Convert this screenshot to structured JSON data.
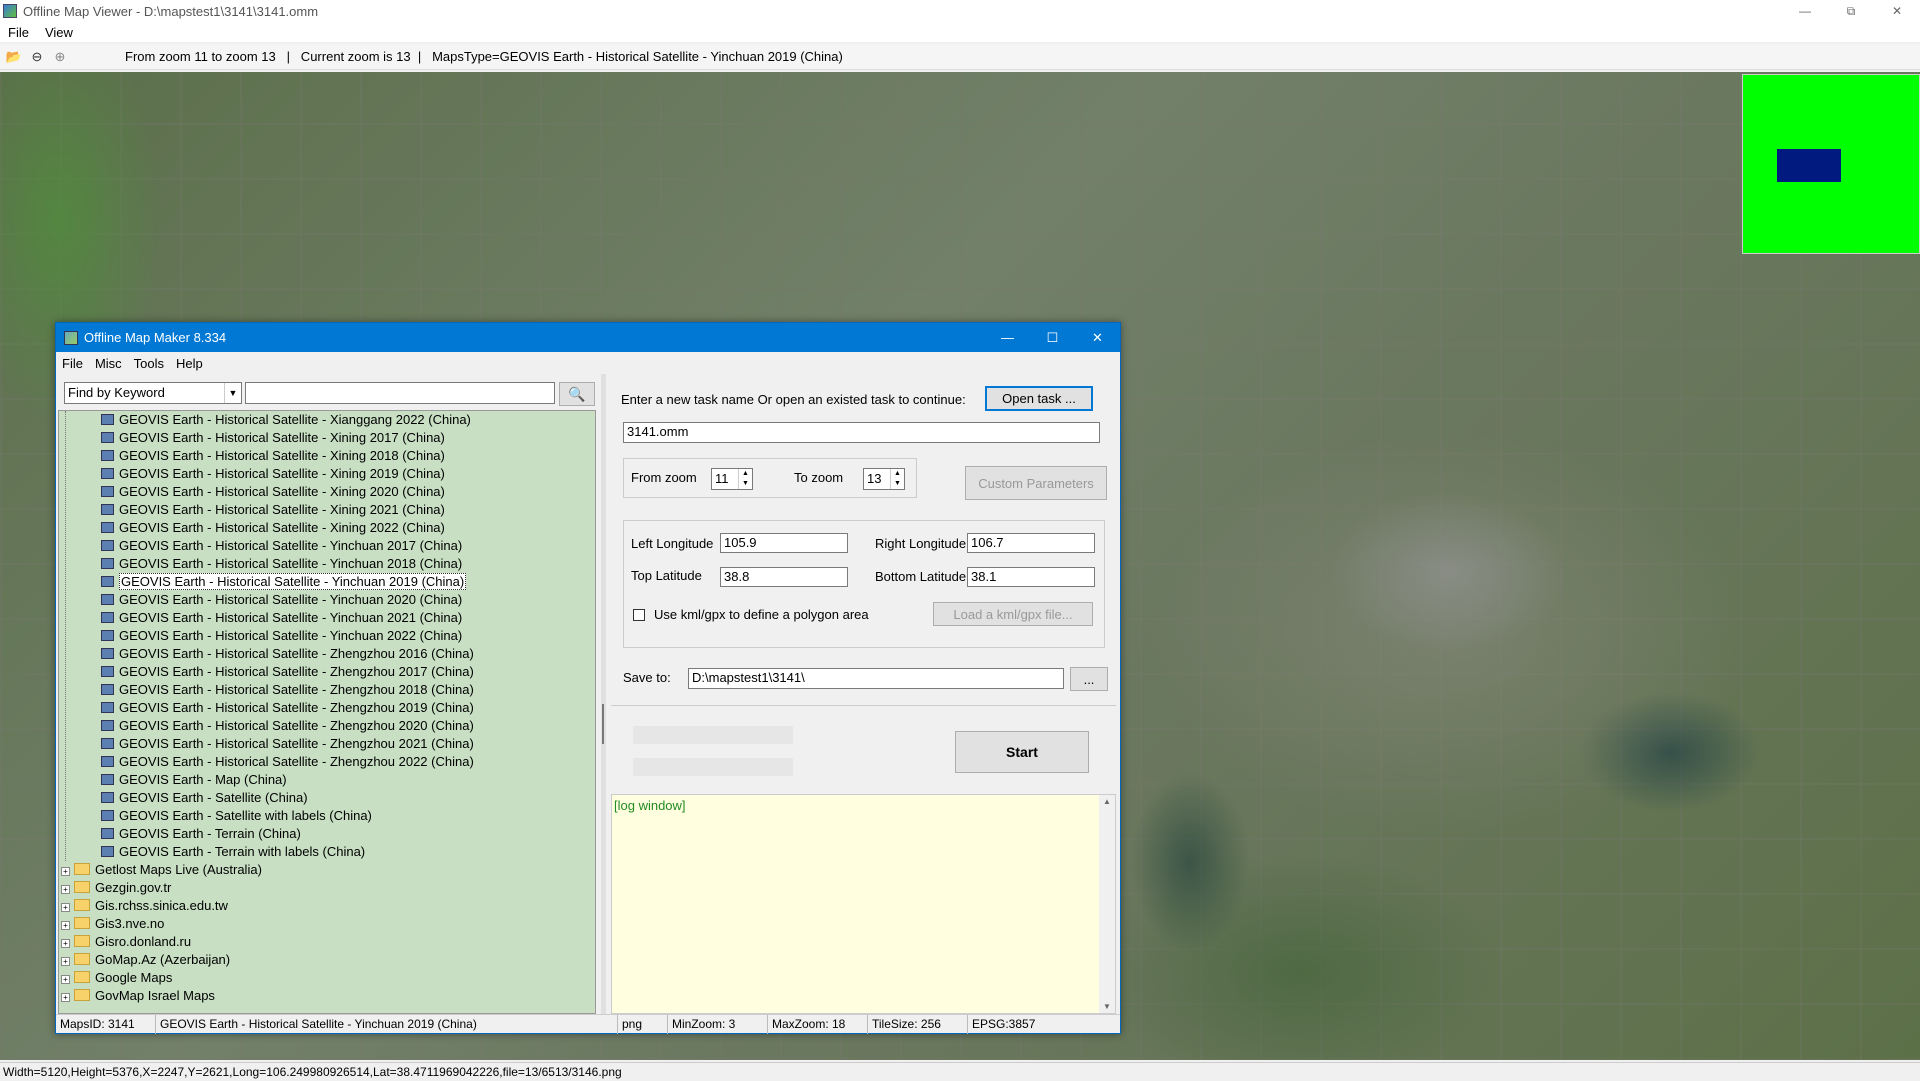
{
  "main_window": {
    "title": "Offline Map Viewer - D:\\mapstest1\\3141\\3141.omm",
    "menu": [
      "File",
      "View"
    ],
    "toolbar_text": "From zoom 11 to zoom 13   |   Current zoom is 13  |   MapsType=GEOVIS Earth - Historical Satellite - Yinchuan 2019 (China)",
    "icons": [
      "open-folder-icon",
      "zoom-out-icon",
      "zoom-in-icon"
    ],
    "status": "Width=5120,Height=5376,X=2247,Y=2621,Long=106.249980926514,Lat=38.4711969042226,file=13/6513/3146.png"
  },
  "minimap": {
    "background": "#00ff00",
    "viewport_color": "#001a80"
  },
  "dialog": {
    "title": "Offline Map Maker 8.334",
    "menu": [
      "File",
      "Misc",
      "Tools",
      "Help"
    ],
    "search": {
      "mode": "Find by Keyword",
      "keyword": ""
    },
    "tree_leaves": [
      "GEOVIS Earth - Historical Satellite - Xianggang 2022 (China)",
      "GEOVIS Earth - Historical Satellite - Xining 2017 (China)",
      "GEOVIS Earth - Historical Satellite - Xining 2018 (China)",
      "GEOVIS Earth - Historical Satellite - Xining 2019 (China)",
      "GEOVIS Earth - Historical Satellite - Xining 2020 (China)",
      "GEOVIS Earth - Historical Satellite - Xining 2021 (China)",
      "GEOVIS Earth - Historical Satellite - Xining 2022 (China)",
      "GEOVIS Earth - Historical Satellite - Yinchuan 2017 (China)",
      "GEOVIS Earth - Historical Satellite - Yinchuan 2018 (China)",
      "GEOVIS Earth - Historical Satellite - Yinchuan 2019 (China)",
      "GEOVIS Earth - Historical Satellite - Yinchuan 2020 (China)",
      "GEOVIS Earth - Historical Satellite - Yinchuan 2021 (China)",
      "GEOVIS Earth - Historical Satellite - Yinchuan 2022 (China)",
      "GEOVIS Earth - Historical Satellite - Zhengzhou 2016 (China)",
      "GEOVIS Earth - Historical Satellite - Zhengzhou 2017 (China)",
      "GEOVIS Earth - Historical Satellite - Zhengzhou 2018 (China)",
      "GEOVIS Earth - Historical Satellite - Zhengzhou 2019 (China)",
      "GEOVIS Earth - Historical Satellite - Zhengzhou 2020 (China)",
      "GEOVIS Earth - Historical Satellite - Zhengzhou 2021 (China)",
      "GEOVIS Earth - Historical Satellite - Zhengzhou 2022 (China)",
      "GEOVIS Earth - Map (China)",
      "GEOVIS Earth - Satellite (China)",
      "GEOVIS Earth - Satellite with labels (China)",
      "GEOVIS Earth - Terrain (China)",
      "GEOVIS Earth - Terrain with labels (China)"
    ],
    "selected_leaf": "GEOVIS Earth - Historical Satellite - Yinchuan 2019 (China)",
    "tree_folders": [
      "Getlost Maps Live (Australia)",
      "Gezgin.gov.tr",
      "Gis.rchss.sinica.edu.tw",
      "Gis3.nve.no",
      "Gisro.donland.ru",
      "GoMap.Az (Azerbaijan)",
      "Google Maps",
      "GovMap Israel Maps"
    ],
    "task_prompt": "Enter a new task name Or open an existed task to continue:",
    "open_task_label": "Open task ...",
    "task_name": "3141.omm",
    "from_zoom_label": "From zoom",
    "from_zoom": "11",
    "to_zoom_label": "To zoom",
    "to_zoom": "13",
    "custom_params_label": "Custom Parameters",
    "left_lon_label": "Left Longitude",
    "left_lon": "105.9",
    "right_lon_label": "Right Longitude",
    "right_lon": "106.7",
    "top_lat_label": "Top Latitude",
    "top_lat": "38.8",
    "bottom_lat_label": "Bottom Latitude",
    "bottom_lat": "38.1",
    "kml_label": "Use kml/gpx to define a polygon area",
    "load_kml_label": "Load a kml/gpx file...",
    "save_to_label": "Save to:",
    "save_to": "D:\\mapstest1\\3141\\",
    "browse_label": "...",
    "start_label": "Start",
    "log_text": "[log window]",
    "status": {
      "maps_id": "MapsID: 3141",
      "map_name": "GEOVIS Earth - Historical Satellite - Yinchuan 2019 (China)",
      "format": "png",
      "min_zoom": "MinZoom: 3",
      "max_zoom": "MaxZoom: 18",
      "tile_size": "TileSize: 256",
      "epsg": "EPSG:3857"
    }
  }
}
